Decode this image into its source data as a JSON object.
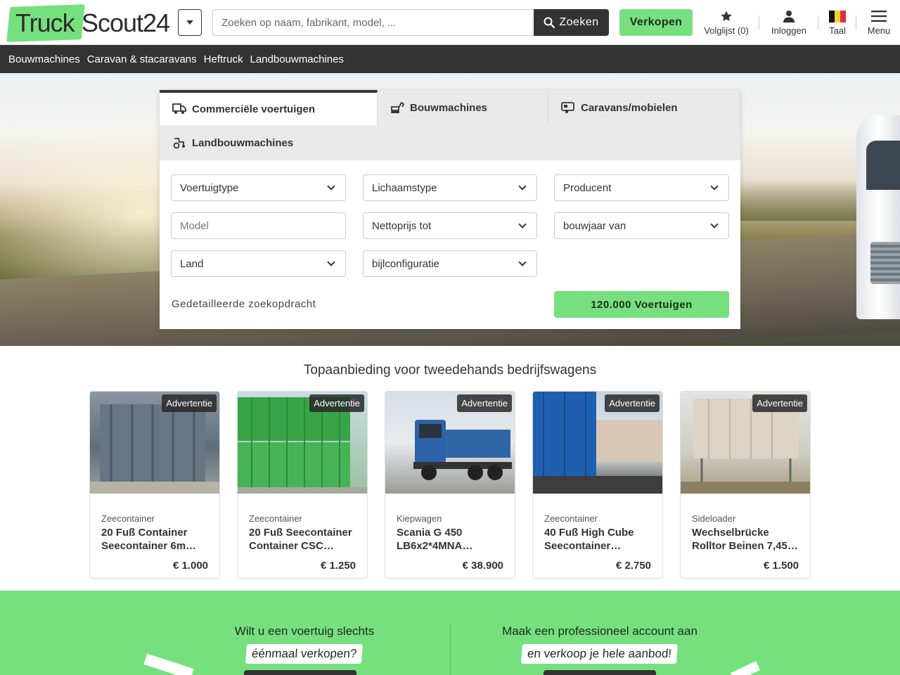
{
  "header": {
    "logo_part1": "Truck",
    "logo_part2": "Scout24",
    "search_placeholder": "Zoeken op naam, fabrikant, model, ...",
    "search_button": "Zoeken",
    "sell_button": "Verkopen",
    "watchlist": "Volglijst (0)",
    "login": "Inloggen",
    "language": "Taal",
    "menu": "Menu"
  },
  "category_nav": [
    "Bouwmachines",
    "Caravan & stacaravans",
    "Heftruck",
    "Landbouwmachines"
  ],
  "search_panel": {
    "tabs": [
      {
        "label": "Commerciële voertuigen",
        "active": true,
        "icon": "van-icon"
      },
      {
        "label": "Bouwmachines",
        "active": false,
        "icon": "excavator-icon"
      },
      {
        "label": "Caravans/mobielen",
        "active": false,
        "icon": "caravan-icon"
      },
      {
        "label": "Landbouwmachines",
        "active": false,
        "icon": "tractor-icon"
      }
    ],
    "fields": {
      "vehicle_type": "Voertuigtype",
      "body_type": "Lichaamstype",
      "producer": "Producent",
      "model_placeholder": "Model",
      "net_price": "Nettoprijs tot",
      "year_from": "bouwjaar van",
      "country": "Land",
      "axle_config": "bijlconfiguratie"
    },
    "detailed_search": "Gedetailleerde zoekopdracht",
    "results_button": "120.000 Voertuigen"
  },
  "offers": {
    "title": "Topaanbieding voor tweedehands bedrijfswagens",
    "ad_label": "Advertentie",
    "items": [
      {
        "type": "Zeecontainer",
        "title": "20 Fuß Container Seecontainer 6m…",
        "price": "€ 1.000",
        "color": "#6f7f8c"
      },
      {
        "type": "Zeecontainer",
        "title": "20 Fuß Seecontainer Container CSC…",
        "price": "€ 1.250",
        "color": "#3fae4a"
      },
      {
        "type": "Kiepwagen",
        "title": "Scania G 450 LB6x2*4MNA…",
        "price": "€ 38.900",
        "color": "#2f66a8"
      },
      {
        "type": "Zeecontainer",
        "title": "40 Fuß High Cube Seecontainer…",
        "price": "€ 2.750",
        "color": "#1f5fb0"
      },
      {
        "type": "Sideloader",
        "title": "Wechselbrücke Rolltor Beinen 7,45…",
        "price": "€ 1.500",
        "color": "#d9d3c2"
      }
    ]
  },
  "sell_section": {
    "left_question": "Wilt u een voertuig slechts",
    "left_highlight": "éénmaal verkopen?",
    "right_question": "Maak een professioneel account aan",
    "right_highlight": "en verkoop je hele aanbod!"
  },
  "colors": {
    "brand_green": "#76e07e",
    "dark": "#333333"
  }
}
